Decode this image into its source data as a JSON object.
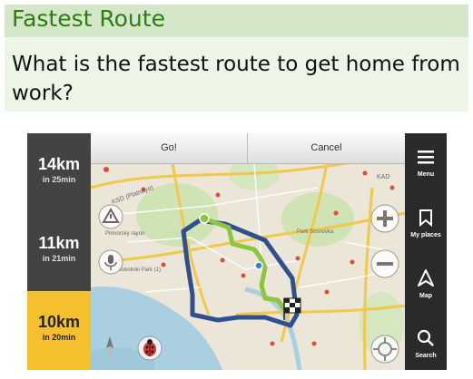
{
  "slide": {
    "title": "Fastest Route",
    "question": "What is the fastest route to get home from work?"
  },
  "app": {
    "top_buttons": {
      "go": "Go!",
      "cancel": "Cancel"
    },
    "routes": [
      {
        "distance": "14km",
        "time": "in 25min",
        "selected": false
      },
      {
        "distance": "11km",
        "time": "in 21min",
        "selected": false
      },
      {
        "distance": "10km",
        "time": "in 20min",
        "selected": true
      }
    ],
    "right_menu": [
      {
        "label": "Menu",
        "icon": "menu-icon"
      },
      {
        "label": "My places",
        "icon": "bookmark-icon"
      },
      {
        "label": "Map",
        "icon": "map-icon"
      },
      {
        "label": "Search",
        "icon": "search-icon"
      }
    ],
    "map_labels": {
      "ksd": "KSD (Platnaya)",
      "primorsky": "Primorsky rayon",
      "zoo": "Sokolniki Park (1)",
      "park": "Park Sosnovka",
      "kad": "KAD"
    },
    "colors": {
      "route_fast": "#8cc63f",
      "route_alt": "#2f4f8e",
      "selected_route": "#f6bf2d",
      "panel_dark": "#2a2a2a"
    }
  }
}
